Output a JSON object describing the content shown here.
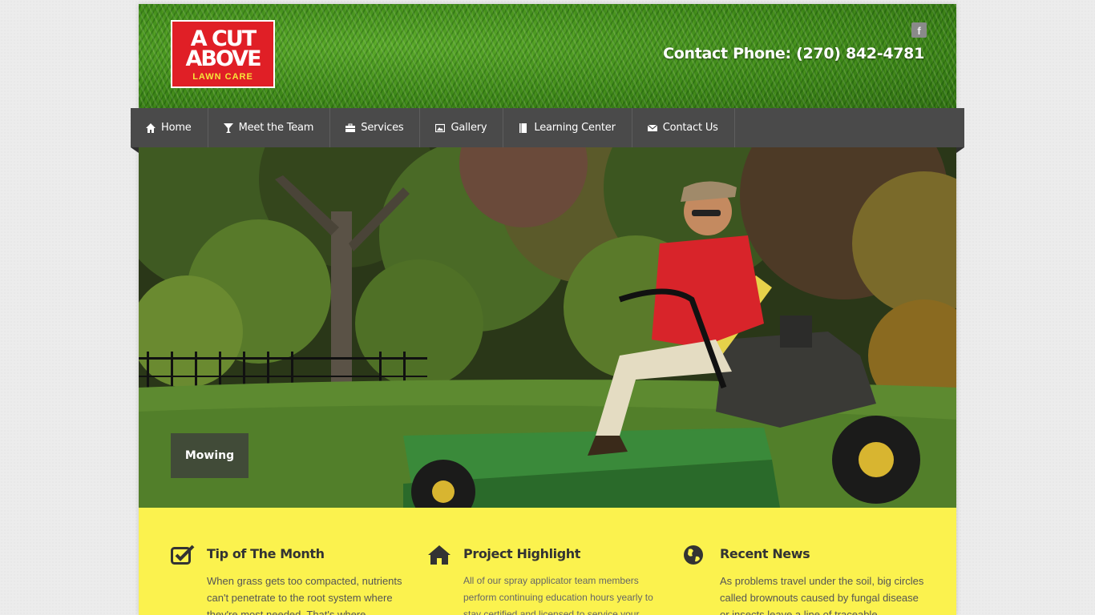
{
  "header": {
    "logo": {
      "line1": "A CUT",
      "line2": "ABOVE",
      "line3": "LAWN CARE"
    },
    "social_icon": "facebook-icon",
    "phone": "Contact Phone: (270) 842-4781"
  },
  "nav": {
    "items": [
      {
        "label": "Home",
        "icon": "home-icon"
      },
      {
        "label": "Meet the Team",
        "icon": "glass-icon"
      },
      {
        "label": "Services",
        "icon": "briefcase-icon"
      },
      {
        "label": "Gallery",
        "icon": "picture-icon"
      },
      {
        "label": "Learning Center",
        "icon": "book-icon"
      },
      {
        "label": "Contact Us",
        "icon": "envelope-icon"
      }
    ]
  },
  "hero": {
    "caption": "Mowing"
  },
  "features": [
    {
      "title": "Tip of The Month",
      "icon": "checkbox-icon",
      "text": "When grass gets too compacted, nutrients can't penetrate to the root system where they're most needed. That's where"
    },
    {
      "title": "Project Highlight",
      "icon": "house-icon",
      "text": "All of our spray applicator team members perform continuing education hours yearly to stay certified and licensed to service your"
    },
    {
      "title": "Recent News",
      "icon": "globe-icon",
      "text": "As problems travel under the soil, big circles called brownouts caused by fungal disease or insects leave a line of traceable"
    }
  ],
  "colors": {
    "nav": "#4a4a4a",
    "feature_band": "#fbf24e",
    "logo_red": "#e01f26"
  }
}
